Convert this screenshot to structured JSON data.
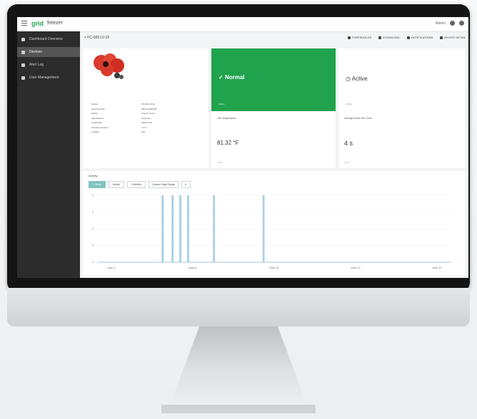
{
  "topbar": {
    "logo": "grid",
    "brand": "freezer",
    "user": "Admin"
  },
  "sidebar": {
    "items": [
      {
        "label": "Dashboard Overview",
        "icon": "dashboard-icon",
        "active": false
      },
      {
        "label": "Devices",
        "icon": "device-icon",
        "active": true
      },
      {
        "label": "Alert Log",
        "icon": "alert-icon",
        "active": false
      },
      {
        "label": "User Management",
        "icon": "user-icon",
        "active": false
      }
    ]
  },
  "breadcrumb": "< FC-083 LV-19",
  "actions": [
    {
      "label": "THRESHOLDS",
      "icon": "threshold-icon"
    },
    {
      "label": "DOWNLOAD",
      "icon": "download-icon"
    },
    {
      "label": "NOTIFICATIONS",
      "icon": "bell-icon"
    },
    {
      "label": "DEVICE DETAIL",
      "icon": "settings-icon"
    }
  ],
  "device": {
    "properties": [
      {
        "key": "Device",
        "value": "FC-083 LV-19"
      },
      {
        "key": "Serial Number",
        "value": "ABC123456789"
      },
      {
        "key": "Model",
        "value": "Freezer Unit 2"
      },
      {
        "key": "Manufacturer",
        "value": "Grid Labs"
      },
      {
        "key": "Install Date",
        "value": "2020-01-01"
      },
      {
        "key": "Firmware Version",
        "value": "1.0.0"
      },
      {
        "key": "Location",
        "value": "Lab"
      }
    ]
  },
  "status": {
    "label": "Normal",
    "sub": "Status"
  },
  "activity": {
    "label": "Active",
    "sub": "Activity"
  },
  "metrics": {
    "temperature": {
      "title": "Cell Temperature",
      "value": "81.32 °F",
      "foot": "Latest"
    },
    "runtime": {
      "title": "Average Motor Run Time",
      "value": "4 s",
      "foot": "Today"
    }
  },
  "chart_panel": {
    "title": "Activity",
    "filters": [
      "1 Week",
      "Month",
      "3 Months"
    ],
    "range": "Custom Date Range",
    "active_filter": 0
  },
  "colors": {
    "accent": "#20a34d",
    "sidebar": "#2c2c2c",
    "bar": "#a9cfe6",
    "filter_on": "#7fc4c0"
  },
  "chart_data": {
    "type": "bar",
    "xticks": [
      "May 1",
      "May 8",
      "May 15",
      "May 22",
      "May 29"
    ],
    "ylim": [
      0,
      1
    ],
    "spikes": [
      {
        "x": 0.185,
        "y": 1.0
      },
      {
        "x": 0.213,
        "y": 1.0
      },
      {
        "x": 0.235,
        "y": 1.0
      },
      {
        "x": 0.257,
        "y": 1.0
      },
      {
        "x": 0.33,
        "y": 1.0
      },
      {
        "x": 0.47,
        "y": 1.0
      }
    ]
  }
}
